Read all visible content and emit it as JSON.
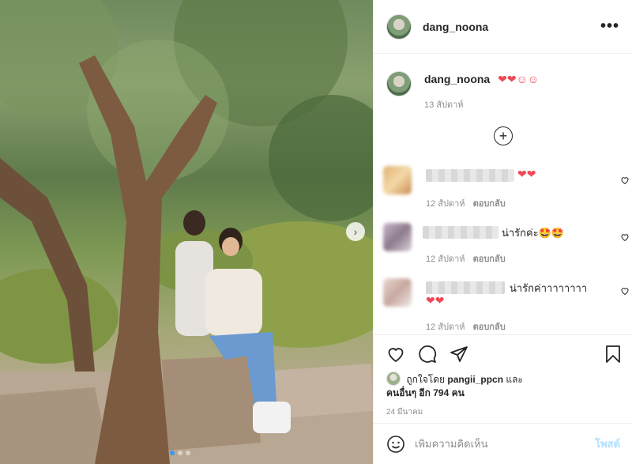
{
  "post": {
    "username": "dang_noona",
    "more_icon": "more-horizontal-icon",
    "next_icon": "chevron-right-icon",
    "carousel_dots": 3
  },
  "caption": {
    "username": "dang_noona",
    "text": "❤❤☺☺",
    "time": "13 สัปดาห์"
  },
  "load_more_icon": "plus-circle-icon",
  "comments": [
    {
      "text": "❤❤",
      "time": "12 สัปดาห์",
      "reply": "ตอบกลับ"
    },
    {
      "text": "น่ารักค่ะ🤩🤩",
      "time": "12 สัปดาห์",
      "reply": "ตอบกลับ"
    },
    {
      "text": "น่ารักค่าาาาาาาา",
      "text2": "❤❤",
      "time": "12 สัปดาห์",
      "reply": "ตอบกลับ"
    }
  ],
  "likes": {
    "prefix": "ถูกใจโดย",
    "user": "pangii_ppcn",
    "and": "และ",
    "others": "คนอื่นๆ อีก 794 คน"
  },
  "date": "24 มีนาคม",
  "comment_input": {
    "placeholder": "เพิ่มความคิดเห็น",
    "post_label": "โพสต์"
  },
  "colors": {
    "accent": "#3897f0",
    "heart": "#ed4956",
    "muted": "#8e8e8e"
  }
}
